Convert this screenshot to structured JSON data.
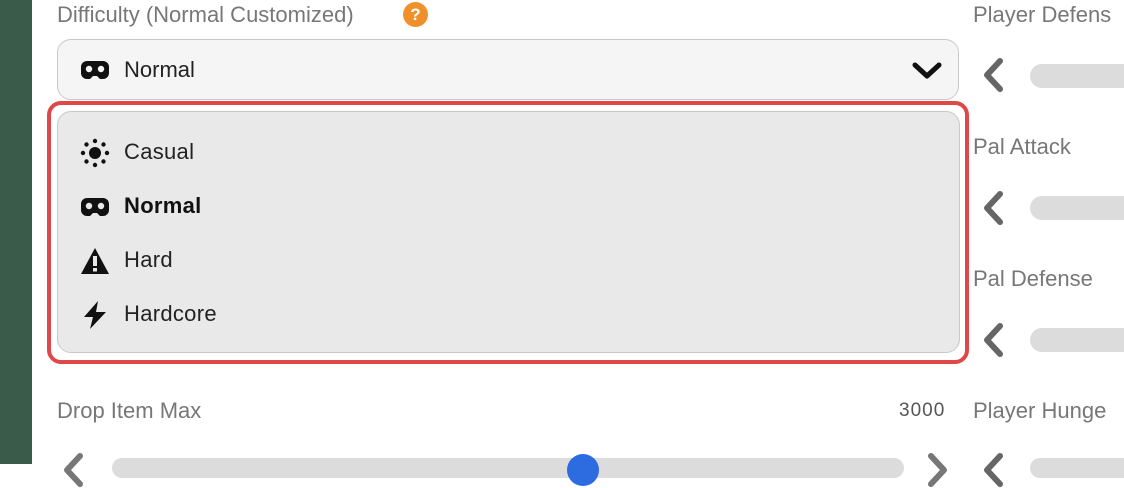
{
  "difficulty": {
    "label": "Difficulty (Normal Customized)",
    "help_icon": "?",
    "selected_value": "Normal",
    "selected_icon": "gamepad-icon",
    "options": [
      {
        "label": "Casual",
        "icon": "sun-icon",
        "selected": false
      },
      {
        "label": "Normal",
        "icon": "gamepad-icon",
        "selected": true
      },
      {
        "label": "Hard",
        "icon": "warning-icon",
        "selected": false
      },
      {
        "label": "Hardcore",
        "icon": "lightning-icon",
        "selected": false
      }
    ]
  },
  "right_column": {
    "player_defense_label": "Player Defens",
    "pal_attack_label": "Pal Attack",
    "pal_defense_label": "Pal Defense",
    "player_hunger_label": "Player Hunge"
  },
  "drop_item_max": {
    "label": "Drop Item Max",
    "value": "3000"
  },
  "colors": {
    "highlight": "#e04848",
    "help_icon": "#f0902a",
    "slider_thumb": "#2c6be0",
    "sidebar": "#3a5a4a"
  }
}
